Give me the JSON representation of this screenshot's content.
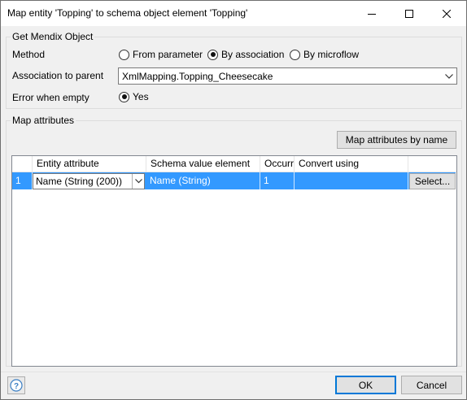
{
  "window": {
    "title": "Map entity 'Topping' to schema object element 'Topping'"
  },
  "get_object": {
    "group_label": "Get Mendix Object",
    "method_label": "Method",
    "method_options": [
      {
        "label": "From parameter",
        "checked": false
      },
      {
        "label": "By association",
        "checked": true
      },
      {
        "label": "By microflow",
        "checked": false
      }
    ],
    "association_label": "Association to parent",
    "association_value": "XmlMapping.Topping_Cheesecake",
    "error_label": "Error when empty",
    "error_option": {
      "label": "Yes",
      "checked": true
    }
  },
  "map_attributes": {
    "group_label": "Map attributes",
    "map_button_label": "Map attributes by name",
    "columns": [
      "",
      "Entity attribute",
      "Schema value element",
      "Occurrence",
      "Convert using",
      ""
    ],
    "rows": [
      {
        "index": "1",
        "entity_attribute": "Name (String (200))",
        "schema_value": "Name (String)",
        "occurrence": "1",
        "convert_using": "",
        "action": "Select..."
      }
    ]
  },
  "footer": {
    "ok_label": "OK",
    "cancel_label": "Cancel"
  },
  "colors": {
    "selection": "#3399ff",
    "primary_border": "#0078d7"
  }
}
